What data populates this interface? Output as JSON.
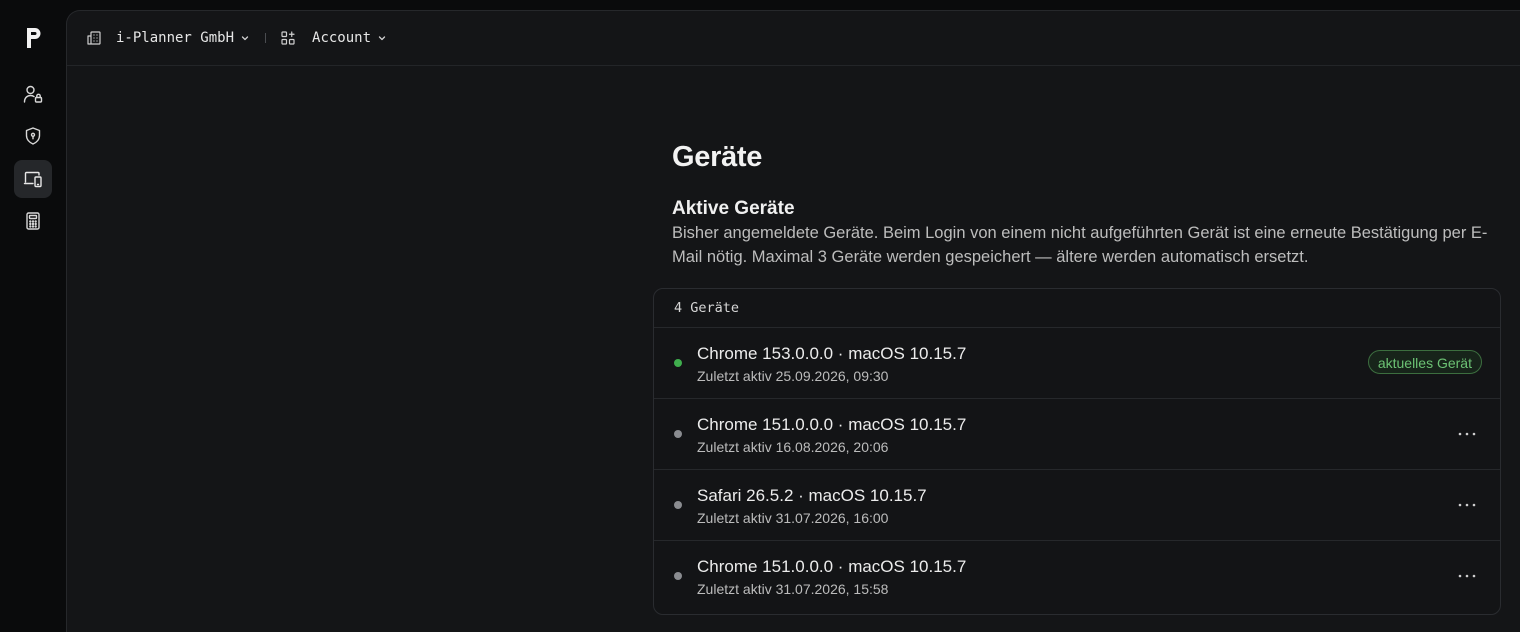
{
  "topbar": {
    "org_label": "i-Planner GmbH",
    "section_label": "Account"
  },
  "sidebar": {
    "items": [
      {
        "name": "users",
        "icon": "user-lock-icon"
      },
      {
        "name": "security",
        "icon": "shield-icon"
      },
      {
        "name": "devices",
        "icon": "devices-icon",
        "active": true
      },
      {
        "name": "billing",
        "icon": "calculator-icon"
      }
    ]
  },
  "main": {
    "title": "Geräte",
    "section_title": "Aktive Geräte",
    "section_desc": "Bisher angemeldete Geräte. Beim Login von einem nicht aufgeführten Gerät ist eine erneute Bestätigung per E-Mail nötig. Maximal 3 Geräte werden gespeichert — ältere werden automatisch ersetzt."
  },
  "devices": {
    "count_label": "4 Geräte",
    "current_badge": "aktuelles Gerät",
    "rows": [
      {
        "name": "Chrome 153.0.0.0 · macOS 10.15.7",
        "meta": "Zuletzt aktiv 25.09.2026, 09:30"
      },
      {
        "name": "Chrome 151.0.0.0 · macOS 10.15.7",
        "meta": "Zuletzt aktiv 16.08.2026, 20:06"
      },
      {
        "name": "Safari 26.5.2 · macOS 10.15.7",
        "meta": "Zuletzt aktiv 31.07.2026, 16:00"
      },
      {
        "name": "Chrome 151.0.0.0 · macOS 10.15.7",
        "meta": "Zuletzt aktiv 31.07.2026, 15:58"
      }
    ]
  },
  "colors": {
    "online": "#3fae4d",
    "offline": "#8a8c90",
    "badge_text": "#6cc274",
    "panel_bg": "#141517",
    "rail_bg": "#0a0b0c"
  }
}
